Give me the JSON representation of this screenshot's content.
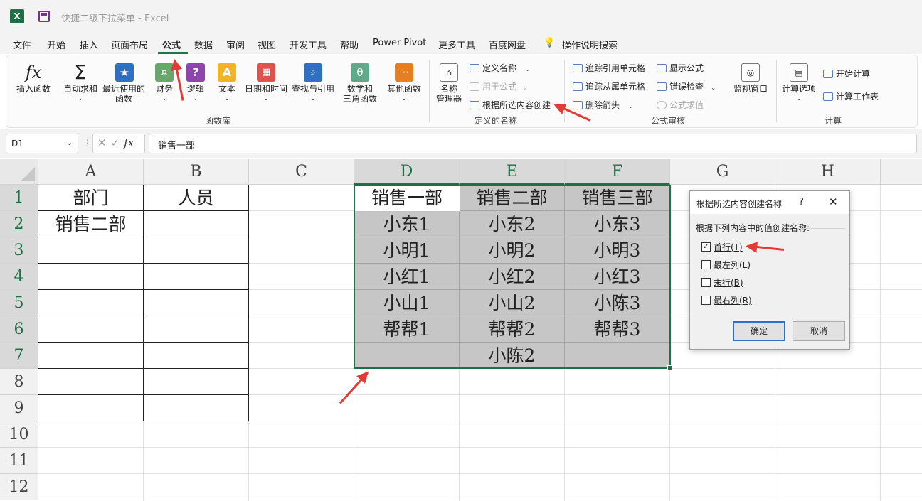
{
  "window": {
    "app_icon": "X",
    "title": "快捷二级下拉菜单  -  Excel"
  },
  "menu": {
    "tabs": [
      "文件",
      "开始",
      "插入",
      "页面布局",
      "公式",
      "数据",
      "审阅",
      "视图",
      "开发工具",
      "帮助",
      "Power Pivot",
      "更多工具",
      "百度网盘",
      "操作说明搜索"
    ],
    "active_tab": "公式"
  },
  "ribbon": {
    "insert_function": "插入函数",
    "autosum": "自动求和",
    "recent_line1": "最近使用的",
    "recent_line2": "函数",
    "financial": "财务",
    "logical": "逻辑",
    "text": "文本",
    "datetime": "日期和时间",
    "lookup": "查找与引用",
    "math_line1": "数学和",
    "math_line2": "三角函数",
    "more_functions": "其他函数",
    "group_function_library": "函数库",
    "name_manager_line1": "名称",
    "name_manager_line2": "管理器",
    "define_name": "定义名称",
    "use_in_formula": "用于公式",
    "create_from_selection": "根据所选内容创建",
    "group_defined_names": "定义的名称",
    "trace_precedents": "追踪引用单元格",
    "trace_dependents": "追踪从属单元格",
    "remove_arrows": "删除箭头",
    "show_formulas": "显示公式",
    "error_checking": "错误检查",
    "evaluate_formula": "公式求值",
    "watch_window": "监视窗口",
    "group_formula_auditing": "公式审核",
    "calc_options": "计算选项",
    "calc_now": "开始计算",
    "calc_sheet": "计算工作表",
    "group_calculation": "计算",
    "accent_color": "#1e7145"
  },
  "formula_bar": {
    "name_box": "D1",
    "formula": "销售一部"
  },
  "grid": {
    "columns": [
      "A",
      "B",
      "C",
      "D",
      "E",
      "F",
      "G",
      "H"
    ],
    "rows": [
      "1",
      "2",
      "3",
      "4",
      "5",
      "6",
      "7",
      "8",
      "9",
      "10",
      "11",
      "12"
    ],
    "table1": {
      "header": [
        "部门",
        "人员"
      ],
      "row2": [
        "销售二部",
        ""
      ]
    },
    "table2": {
      "rows": [
        [
          "销售一部",
          "销售二部",
          "销售三部"
        ],
        [
          "小东1",
          "小东2",
          "小东3"
        ],
        [
          "小明1",
          "小明2",
          "小明3"
        ],
        [
          "小红1",
          "小红2",
          "小红3"
        ],
        [
          "小山1",
          "小山2",
          "小陈3"
        ],
        [
          "帮帮1",
          "帮帮2",
          "帮帮3"
        ],
        [
          "",
          "小陈2",
          ""
        ]
      ]
    }
  },
  "dialog": {
    "title": "根据所选内容创建名称",
    "help": "?",
    "close": "✕",
    "prompt": "根据下列内容中的值创建名称:",
    "options": [
      {
        "label": "首行(T)",
        "checked": true
      },
      {
        "label": "最左列(L)",
        "checked": false
      },
      {
        "label": "末行(B)",
        "checked": false
      },
      {
        "label": "最右列(R)",
        "checked": false
      }
    ],
    "ok": "确定",
    "cancel": "取消"
  }
}
